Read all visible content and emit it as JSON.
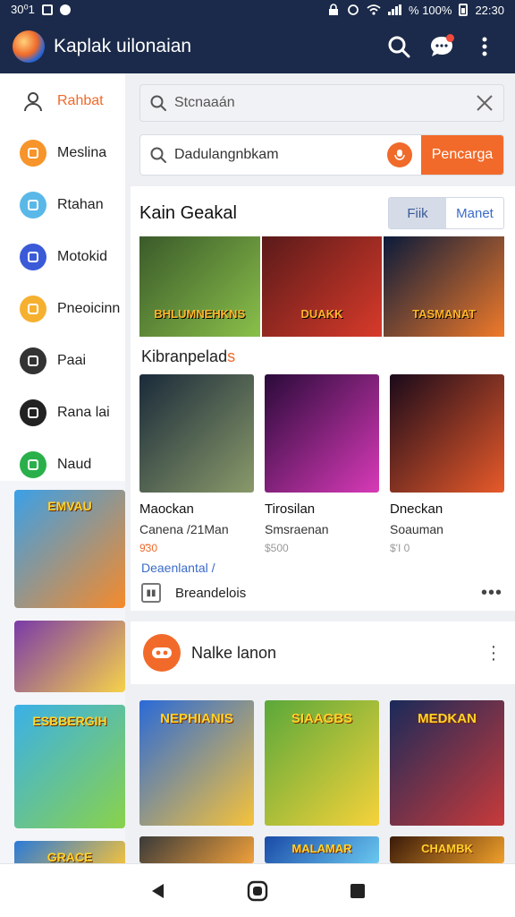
{
  "status_bar": {
    "left_text": "30⁰1",
    "right_percent": "% 100%",
    "time": "22:30"
  },
  "app_bar": {
    "title": "Kaplak uilonaian"
  },
  "sidebar": {
    "items": [
      {
        "label": "Rahbat",
        "icon": "user-icon",
        "color": "#666666"
      },
      {
        "label": "Meslina",
        "icon": "box-icon",
        "color": "#f7942a"
      },
      {
        "label": "Rtahan",
        "icon": "window-icon",
        "color": "#5ab8e8"
      },
      {
        "label": "Motokid",
        "icon": "cross-icon",
        "color": "#3a5ad8"
      },
      {
        "label": "Pneoicinn",
        "icon": "sparkle-icon",
        "color": "#f6b030"
      },
      {
        "label": "Paai",
        "icon": "check-icon",
        "color": "#333333"
      },
      {
        "label": "Rana lai",
        "icon": "shield-icon",
        "color": "#222222"
      },
      {
        "label": "Naud",
        "icon": "ring-icon",
        "color": "#2ab04a"
      }
    ],
    "tiles": [
      {
        "label": "EMVAU",
        "colors": [
          "#3aa0e8",
          "#f68a2a"
        ]
      },
      {
        "label": "",
        "colors": [
          "#7a3aa8",
          "#f6d24a"
        ]
      },
      {
        "label": "ESBBERGIH",
        "colors": [
          "#3ab0e8",
          "#8ad24a"
        ]
      },
      {
        "label": "GRACE",
        "colors": [
          "#2a7ad8",
          "#f6c23a"
        ]
      }
    ]
  },
  "search": {
    "primary_placeholder": "Stcnaaán",
    "secondary_value": "Dadulangnbkam",
    "go_label": "Pencarga"
  },
  "featured": {
    "title": "Kain Geakal",
    "segments": [
      "Fiik",
      "Manet"
    ],
    "banners": [
      {
        "label": "BHLUMNEHKNS",
        "colors": [
          "#3a5a2a",
          "#8ac04a"
        ]
      },
      {
        "label": "DUAKK",
        "colors": [
          "#5a1a1a",
          "#d83a2a"
        ]
      },
      {
        "label": "TASMANAT",
        "colors": [
          "#0a1a3a",
          "#f07a2a"
        ]
      }
    ],
    "section_label": "Kibranpelad",
    "section_label_accent": "s",
    "games": [
      {
        "name": "Maockan",
        "sub": "Canena /21Man",
        "price": "9̃30",
        "hot": true,
        "colors": [
          "#1a2a3a",
          "#8a9a6a"
        ]
      },
      {
        "name": "Tirosilan",
        "sub": "Smsraenan",
        "price": "$500",
        "hot": false,
        "colors": [
          "#2a0a3a",
          "#d83ab8"
        ]
      },
      {
        "name": "Dneckan",
        "sub": "Soauman",
        "price": "$'I 0",
        "hot": false,
        "colors": [
          "#1a0a1a",
          "#e85a2a"
        ]
      }
    ],
    "link_text": "Deaenlantal /",
    "footer_text": "Breandelois"
  },
  "second_card": {
    "title": "Nalke lanon"
  },
  "grid": [
    {
      "label": "NEPHIANIS",
      "colors": [
        "#2a6ad8",
        "#f6c23a"
      ]
    },
    {
      "label": "SIAAGBS",
      "colors": [
        "#5aa83a",
        "#f6d23a"
      ]
    },
    {
      "label": "MEDKAN",
      "colors": [
        "#1a2a5a",
        "#c83a3a"
      ]
    },
    {
      "label": "",
      "colors": [
        "#3a3a3a",
        "#f0a03a"
      ]
    },
    {
      "label": "MALAMAR",
      "colors": [
        "#1a4aa8",
        "#6ac8f0"
      ]
    },
    {
      "label": "CHAMBK",
      "colors": [
        "#3a1a0a",
        "#f0a02a"
      ]
    }
  ],
  "theme": {
    "accent": "#f26a2a",
    "bar": "#1b2a4a",
    "link": "#3a6bc8"
  }
}
